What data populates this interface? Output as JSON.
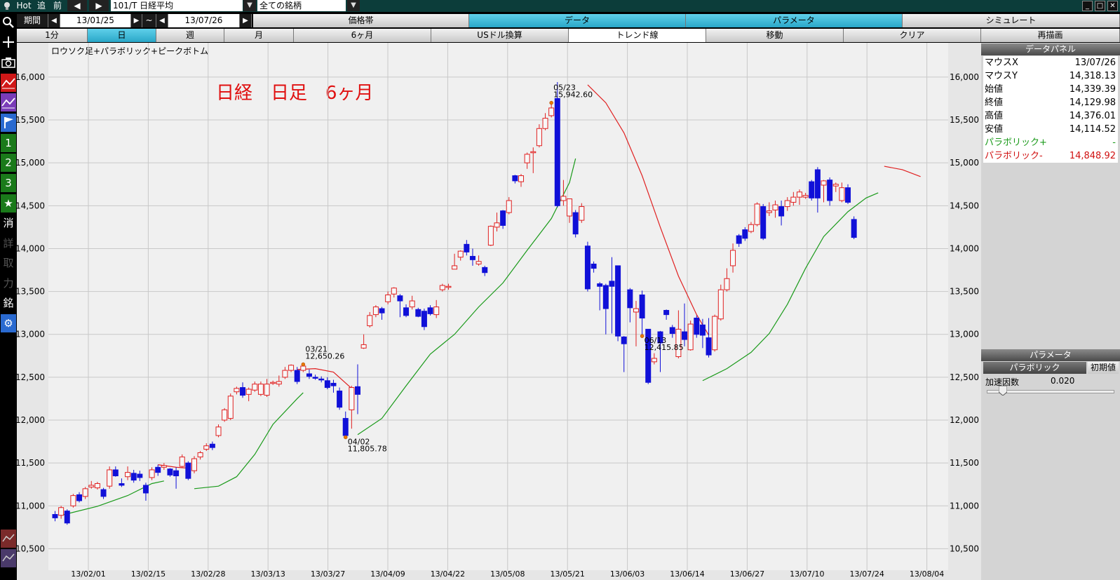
{
  "toolbar": {
    "hot": "Hot",
    "add": "追",
    "prev": "前",
    "symbol": "101/T 日経平均",
    "universe": "全ての銘柄",
    "period_label": "期間",
    "date_from": "13/01/25",
    "tilde": "~",
    "date_to": "13/07/26"
  },
  "tabs": [
    "価格帯",
    "データ",
    "パラメータ",
    "シミュレート"
  ],
  "interval_row": [
    "1分",
    "日",
    "週",
    "月",
    "6ヶ月",
    "USドル換算",
    "トレンド線",
    "移動",
    "クリア",
    "再描画"
  ],
  "left_tools": [
    "1",
    "2",
    "3",
    "消",
    "詳",
    "取",
    "力",
    "銘"
  ],
  "chart_data": {
    "type": "candlestick",
    "title": "ロウソク足+パラボリック+ピークボトム",
    "annotation": "日経　日足　6ヶ月",
    "ylim": [
      10250,
      16400
    ],
    "yticks": [
      "10,500",
      "11,000",
      "11,500",
      "12,000",
      "12,500",
      "13,000",
      "13,500",
      "14,000",
      "14,500",
      "15,000",
      "15,500",
      "16,000"
    ],
    "xticks": [
      "13/02/01",
      "13/02/15",
      "13/02/28",
      "13/03/13",
      "13/03/27",
      "13/04/09",
      "13/04/22",
      "13/05/08",
      "13/05/21",
      "13/06/03",
      "13/06/14",
      "13/06/27",
      "13/07/10",
      "13/07/24",
      "13/08/04"
    ],
    "peaks": [
      {
        "date": "03/21",
        "value": "12,650.26",
        "i": 41
      },
      {
        "date": "04/02",
        "value": "11,805.78",
        "i": 48
      },
      {
        "date": "05/23",
        "value": "15,942.60",
        "i": 82
      },
      {
        "date": "06/13",
        "value": "12,415.85",
        "i": 97
      }
    ],
    "candles": [
      [
        10900,
        10860,
        10820,
        10940
      ],
      [
        10890,
        10980,
        10850,
        11000
      ],
      [
        10940,
        10800,
        10780,
        10960
      ],
      [
        11000,
        11120,
        10980,
        11140
      ],
      [
        11130,
        11060,
        11040,
        11160
      ],
      [
        11110,
        11200,
        11080,
        11220
      ],
      [
        11220,
        11240,
        11200,
        11290
      ],
      [
        11210,
        11260,
        11190,
        11280
      ],
      [
        11190,
        11110,
        11080,
        11210
      ],
      [
        11230,
        11420,
        11200,
        11460
      ],
      [
        11420,
        11350,
        11340,
        11460
      ],
      [
        11260,
        11240,
        11220,
        11320
      ],
      [
        11340,
        11390,
        11300,
        11460
      ],
      [
        11380,
        11300,
        11270,
        11420
      ],
      [
        11370,
        11330,
        11290,
        11410
      ],
      [
        11240,
        11150,
        11060,
        11270
      ],
      [
        11330,
        11420,
        11300,
        11450
      ],
      [
        11450,
        11390,
        11350,
        11480
      ],
      [
        11450,
        11470,
        11420,
        11500
      ],
      [
        11430,
        11360,
        11340,
        11440
      ],
      [
        11410,
        11350,
        11200,
        11450
      ],
      [
        11460,
        11570,
        11440,
        11600
      ],
      [
        11500,
        11320,
        11300,
        11520
      ],
      [
        11410,
        11550,
        11380,
        11580
      ],
      [
        11570,
        11620,
        11540,
        11640
      ],
      [
        11660,
        11700,
        11640,
        11730
      ],
      [
        11720,
        11680,
        11650,
        11750
      ],
      [
        11820,
        11920,
        11800,
        11950
      ],
      [
        12000,
        12120,
        11980,
        12140
      ],
      [
        12020,
        12280,
        12000,
        12310
      ],
      [
        12330,
        12370,
        12300,
        12390
      ],
      [
        12380,
        12290,
        12260,
        12440
      ],
      [
        12300,
        12360,
        12220,
        12380
      ],
      [
        12350,
        12420,
        12330,
        12450
      ],
      [
        12300,
        12420,
        12280,
        12450
      ],
      [
        12290,
        12420,
        12270,
        12480
      ],
      [
        12430,
        12440,
        12410,
        12460
      ],
      [
        12420,
        12450,
        12390,
        12520
      ],
      [
        12500,
        12580,
        12480,
        12620
      ],
      [
        12580,
        12640,
        12560,
        12650
      ],
      [
        12580,
        12450,
        12420,
        12620
      ],
      [
        12580,
        12630,
        12560,
        12650
      ],
      [
        12540,
        12510,
        12480,
        12590
      ],
      [
        12500,
        12490,
        12470,
        12530
      ],
      [
        12480,
        12470,
        12440,
        12510
      ],
      [
        12460,
        12380,
        12360,
        12500
      ],
      [
        12430,
        12400,
        12320,
        12470
      ],
      [
        12340,
        12150,
        12120,
        12380
      ],
      [
        12020,
        11820,
        11800,
        12100
      ],
      [
        12120,
        12380,
        11900,
        12400
      ],
      [
        12390,
        12300,
        12070,
        12650
      ],
      [
        12840,
        12880,
        12830,
        13000
      ],
      [
        13100,
        13220,
        13080,
        13260
      ],
      [
        13230,
        13320,
        13200,
        13340
      ],
      [
        13300,
        13250,
        13170,
        13320
      ],
      [
        13380,
        13460,
        13350,
        13500
      ],
      [
        13470,
        13540,
        13430,
        13550
      ],
      [
        13450,
        13390,
        13200,
        13470
      ],
      [
        13310,
        13220,
        13200,
        13350
      ],
      [
        13320,
        13390,
        13290,
        13450
      ],
      [
        13290,
        13210,
        13200,
        13310
      ],
      [
        13270,
        13090,
        13050,
        13300
      ],
      [
        13310,
        13240,
        13220,
        13340
      ],
      [
        13230,
        13320,
        13190,
        13400
      ],
      [
        13520,
        13570,
        13500,
        13590
      ],
      [
        13560,
        13560,
        13520,
        13590
      ],
      [
        13760,
        13800,
        13770,
        13940
      ],
      [
        13900,
        13970,
        13860,
        13980
      ],
      [
        14050,
        13960,
        13920,
        14100
      ],
      [
        13910,
        13870,
        13800,
        14000
      ],
      [
        13820,
        13850,
        13800,
        13920
      ],
      [
        13780,
        13720,
        13680,
        13800
      ],
      [
        14040,
        14260,
        14030,
        14270
      ],
      [
        14250,
        14300,
        14200,
        14420
      ],
      [
        14440,
        14270,
        14230,
        14450
      ],
      [
        14420,
        14560,
        14400,
        14600
      ],
      [
        14850,
        14790,
        14760,
        14860
      ],
      [
        14780,
        14850,
        14720,
        14870
      ],
      [
        15000,
        15100,
        14930,
        15120
      ],
      [
        15130,
        15130,
        14880,
        15180
      ],
      [
        15200,
        15400,
        15180,
        15450
      ],
      [
        15400,
        15520,
        15380,
        15580
      ],
      [
        15550,
        15640,
        15530,
        15700
      ],
      [
        15750,
        14500,
        14480,
        15942
      ],
      [
        14560,
        14610,
        14500,
        14800
      ],
      [
        14380,
        14580,
        14300,
        14500
      ],
      [
        14420,
        14170,
        14130,
        14450
      ],
      [
        14330,
        14490,
        14300,
        14530
      ],
      [
        14030,
        13530,
        13500,
        14080
      ],
      [
        13820,
        13770,
        13720,
        13850
      ],
      [
        13590,
        13560,
        13280,
        13610
      ],
      [
        13570,
        13300,
        13000,
        13590
      ],
      [
        13620,
        13560,
        13010,
        13900
      ],
      [
        13800,
        12980,
        12920,
        13800
      ],
      [
        12970,
        12890,
        12560,
        12980
      ],
      [
        13520,
        13310,
        13140,
        13540
      ],
      [
        13260,
        13300,
        12860,
        13390
      ],
      [
        13460,
        13190,
        12980,
        13510
      ],
      [
        13060,
        12440,
        12420,
        13060
      ],
      [
        12680,
        12720,
        12650,
        12780
      ],
      [
        13030,
        12900,
        12560,
        13040
      ],
      [
        13280,
        13230,
        13170,
        13290
      ],
      [
        13080,
        13010,
        12960,
        13110
      ],
      [
        12740,
        13060,
        12720,
        13280
      ],
      [
        13030,
        12940,
        12860,
        13360
      ],
      [
        12820,
        13120,
        12810,
        13160
      ],
      [
        13190,
        13000,
        12960,
        13220
      ],
      [
        13110,
        12990,
        12840,
        13180
      ],
      [
        12960,
        12760,
        12730,
        13190
      ],
      [
        12820,
        13210,
        12800,
        13230
      ],
      [
        13180,
        13520,
        13160,
        13580
      ],
      [
        13520,
        13650,
        13500,
        13770
      ],
      [
        13800,
        13980,
        13720,
        14060
      ],
      [
        14150,
        14060,
        14020,
        14170
      ],
      [
        14220,
        14120,
        14090,
        14250
      ],
      [
        14200,
        14280,
        14180,
        14310
      ],
      [
        14280,
        14520,
        14260,
        14540
      ],
      [
        14490,
        14120,
        14100,
        14520
      ],
      [
        14420,
        14440,
        14380,
        14540
      ],
      [
        14450,
        14510,
        14360,
        14560
      ],
      [
        14490,
        14380,
        14270,
        14560
      ],
      [
        14490,
        14560,
        14440,
        14600
      ],
      [
        14540,
        14600,
        14500,
        14660
      ],
      [
        14600,
        14660,
        14510,
        14690
      ],
      [
        14600,
        14620,
        14580,
        14650
      ],
      [
        14780,
        14590,
        14560,
        14800
      ],
      [
        14920,
        14590,
        14420,
        14950
      ],
      [
        14740,
        14790,
        14540,
        14800
      ],
      [
        14800,
        14560,
        14500,
        14830
      ],
      [
        14730,
        14750,
        14660,
        14770
      ],
      [
        14560,
        14710,
        14540,
        14770
      ],
      [
        14710,
        14540,
        14520,
        14750
      ],
      [
        14340,
        14130,
        14110,
        14376
      ]
    ],
    "parabolic": [
      {
        "side": "low",
        "points": [
          [
            1,
            10890
          ],
          [
            7,
            10995
          ],
          [
            12,
            11120
          ],
          [
            16,
            11260
          ],
          [
            18,
            11290
          ]
        ]
      },
      {
        "side": "high",
        "points": [
          [
            17,
            11480
          ],
          [
            20,
            11450
          ],
          [
            22,
            11440
          ]
        ]
      },
      {
        "side": "low",
        "points": [
          [
            23,
            11200
          ],
          [
            27,
            11230
          ],
          [
            30,
            11340
          ],
          [
            33,
            11600
          ],
          [
            36,
            11950
          ],
          [
            40,
            12250
          ],
          [
            41,
            12320
          ]
        ]
      },
      {
        "side": "high",
        "points": [
          [
            40,
            12590
          ],
          [
            43,
            12600
          ],
          [
            46,
            12560
          ],
          [
            49,
            12370
          ]
        ]
      },
      {
        "side": "low",
        "points": [
          [
            50,
            11830
          ],
          [
            54,
            12020
          ],
          [
            58,
            12400
          ],
          [
            62,
            12770
          ],
          [
            66,
            13000
          ],
          [
            70,
            13320
          ],
          [
            74,
            13600
          ],
          [
            78,
            13980
          ],
          [
            82,
            14350
          ],
          [
            85,
            14770
          ],
          [
            86,
            15050
          ]
        ]
      },
      {
        "side": "high",
        "points": [
          [
            88,
            15910
          ],
          [
            91,
            15700
          ],
          [
            94,
            15350
          ],
          [
            97,
            14850
          ],
          [
            100,
            14250
          ],
          [
            103,
            13680
          ],
          [
            106,
            13230
          ],
          [
            108,
            12990
          ]
        ]
      },
      {
        "side": "low",
        "points": [
          [
            107,
            12460
          ],
          [
            111,
            12600
          ],
          [
            115,
            12790
          ],
          [
            118,
            13010
          ],
          [
            121,
            13350
          ],
          [
            124,
            13770
          ],
          [
            127,
            14140
          ],
          [
            131,
            14430
          ],
          [
            134,
            14590
          ],
          [
            136,
            14650
          ]
        ]
      },
      {
        "side": "high",
        "points": [
          [
            137,
            14960
          ],
          [
            140,
            14920
          ],
          [
            143,
            14840
          ]
        ]
      }
    ]
  },
  "data_panel": {
    "title": "データパネル",
    "rows": [
      {
        "k": "マウスX",
        "v": "13/07/26",
        "color": "#000"
      },
      {
        "k": "マウスY",
        "v": "14,318.13",
        "color": "#000"
      },
      {
        "k": "始値",
        "v": "14,339.39",
        "color": "#000"
      },
      {
        "k": "終値",
        "v": "14,129.98",
        "color": "#000"
      },
      {
        "k": "高値",
        "v": "14,376.01",
        "color": "#000"
      },
      {
        "k": "安値",
        "v": "14,114.52",
        "color": "#000"
      },
      {
        "k": "パラボリック+",
        "v": "-",
        "color": "#1a9a1a"
      },
      {
        "k": "パラボリック-",
        "v": "14,848.92",
        "color": "#d01010"
      }
    ]
  },
  "param_panel": {
    "title": "パラメータ",
    "tab": "パラボリック",
    "reset": "初期値",
    "label": "加速因数",
    "value": "0.020",
    "slider_fraction": 0.1
  },
  "colors": {
    "up": "#e02020",
    "down": "#1010d8",
    "green": "#1a9a1a",
    "red": "#e02020",
    "peak": "#e87800"
  }
}
